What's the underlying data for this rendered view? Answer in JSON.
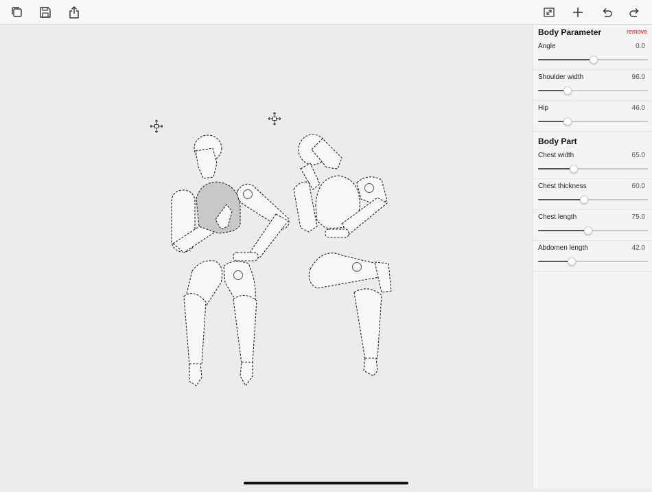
{
  "toolbar": {
    "left_icons": [
      "duplicate-icon",
      "save-icon",
      "share-icon"
    ],
    "right_icons": [
      "expand-icon",
      "add-icon",
      "undo-icon",
      "redo-icon"
    ]
  },
  "panel": {
    "body_parameter_title": "Body Parameter",
    "remove_label": "remove",
    "body_parameters": [
      {
        "label": "Angle",
        "value": "0.0",
        "fraction": 0.5
      },
      {
        "label": "Shoulder width",
        "value": "96.0",
        "fraction": 0.26
      },
      {
        "label": "Hip",
        "value": "46.0",
        "fraction": 0.26
      }
    ],
    "body_part_title": "Body Part",
    "body_parts": [
      {
        "label": "Chest width",
        "value": "65.0",
        "fraction": 0.32
      },
      {
        "label": "Chest thickness",
        "value": "60.0",
        "fraction": 0.41
      },
      {
        "label": "Chest length",
        "value": "75.0",
        "fraction": 0.45
      },
      {
        "label": "Abdomen length",
        "value": "42.0",
        "fraction": 0.3
      }
    ]
  },
  "canvas": {
    "move_handle_icons": [
      "move-handle-icon",
      "move-handle-icon"
    ]
  },
  "colors": {
    "accent_remove": "#e0261c",
    "selected_part": "#c8c8c8",
    "background": "#ececec"
  }
}
